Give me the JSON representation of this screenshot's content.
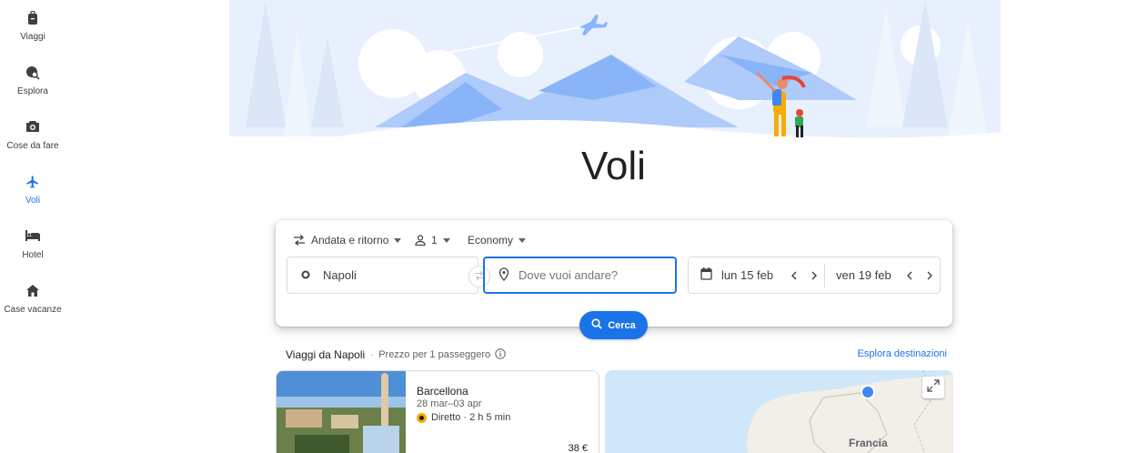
{
  "nav": {
    "items": [
      {
        "label": "Viaggi",
        "icon": "luggage-icon"
      },
      {
        "label": "Esplora",
        "icon": "explore-icon"
      },
      {
        "label": "Cose da fare",
        "icon": "camera-icon"
      },
      {
        "label": "Voli",
        "icon": "flight-icon",
        "active": true
      },
      {
        "label": "Hotel",
        "icon": "hotel-bed-icon"
      },
      {
        "label": "Case vacanze",
        "icon": "home-icon"
      }
    ]
  },
  "hero": {
    "title": "Voli"
  },
  "search": {
    "trip_type": "Andata e ritorno",
    "passengers": "1",
    "cabin_class": "Economy",
    "origin": "Napoli",
    "destination_placeholder": "Dove vuoi andare?",
    "depart_date": "lun 15 feb",
    "return_date": "ven 19 feb",
    "search_label": "Cerca"
  },
  "trips": {
    "heading": "Viaggi da Napoli",
    "price_note": "Prezzo per 1 passeggero",
    "explore_link": "Esplora destinazioni",
    "items": [
      {
        "city": "Barcellona",
        "dates": "28 mar–03 apr",
        "stops": "Diretto",
        "duration": "2 h 5 min",
        "price": "38 €"
      }
    ]
  },
  "map": {
    "country_label": "Francia"
  },
  "colors": {
    "accent": "#1a73e8",
    "nav_text": "#3c4043",
    "border": "#dadce0",
    "hero_sky": "#e8f0fe"
  }
}
